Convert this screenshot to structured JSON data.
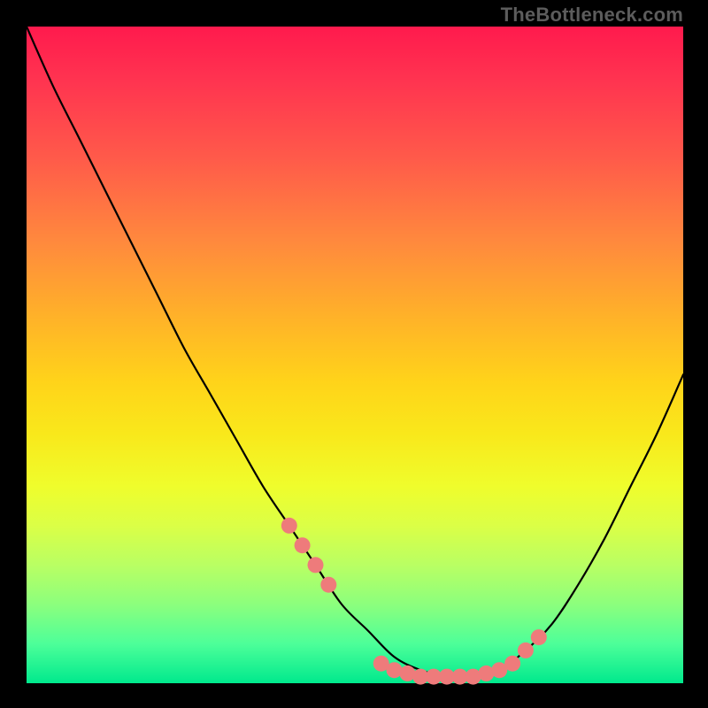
{
  "watermark": "TheBottleneck.com",
  "chart_data": {
    "type": "line",
    "title": "",
    "xlabel": "",
    "ylabel": "",
    "xlim": [
      0,
      100
    ],
    "ylim": [
      0,
      100
    ],
    "series": [
      {
        "name": "bottleneck-curve",
        "x": [
          0,
          4,
          8,
          12,
          16,
          20,
          24,
          28,
          32,
          36,
          40,
          44,
          48,
          52,
          56,
          60,
          64,
          68,
          72,
          76,
          80,
          84,
          88,
          92,
          96,
          100
        ],
        "y": [
          100,
          91,
          83,
          75,
          67,
          59,
          51,
          44,
          37,
          30,
          24,
          18,
          12,
          8,
          4,
          2,
          1,
          1,
          2,
          5,
          9,
          15,
          22,
          30,
          38,
          47
        ]
      }
    ],
    "markers": {
      "name": "highlighted-points",
      "color": "#f08080",
      "x": [
        40,
        42,
        44,
        46,
        54,
        56,
        58,
        60,
        62,
        64,
        66,
        68,
        70,
        72,
        74,
        76,
        78
      ],
      "y": [
        24,
        21,
        18,
        15,
        3,
        2,
        1.5,
        1,
        1,
        1,
        1,
        1,
        1.5,
        2,
        3,
        5,
        7
      ]
    }
  },
  "colors": {
    "curve": "#000000",
    "marker": "#ee7b7b",
    "background_top": "#ff1a4d",
    "background_bottom": "#00e98d"
  }
}
